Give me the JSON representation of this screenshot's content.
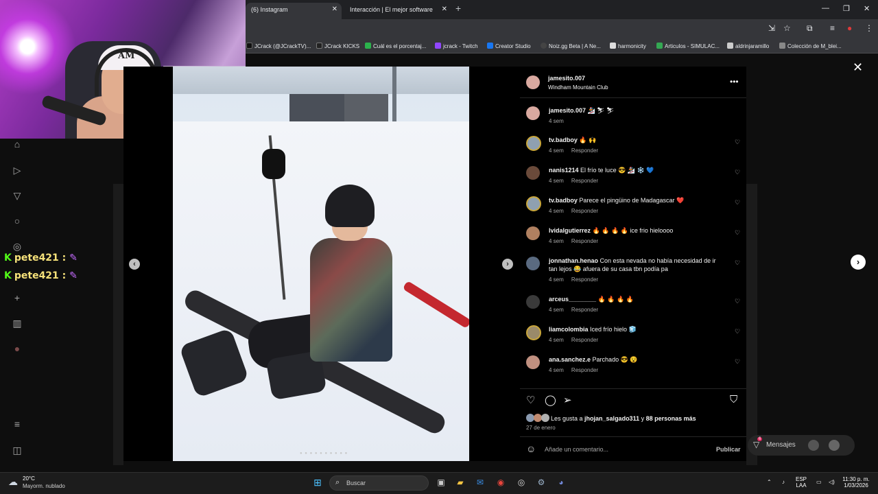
{
  "browser": {
    "tabs": [
      {
        "label": "(6) Instagram"
      },
      {
        "label": "Interacción | El mejor software"
      }
    ],
    "bookmarks": [
      {
        "label": "JCrack (@JCrackTV)...",
        "color": "#111111"
      },
      {
        "label": "JCrack KICKS",
        "color": "#222222"
      },
      {
        "label": "Cuál es el porcentaj...",
        "color": "#2bb24c"
      },
      {
        "label": "jcrack - Twitch",
        "color": "#9146ff"
      },
      {
        "label": "Creator Studio",
        "color": "#1877f2"
      },
      {
        "label": "Noiz.gg Beta | A Ne...",
        "color": "#444444"
      },
      {
        "label": "harmonicity",
        "color": "#dddddd"
      },
      {
        "label": "Articulos - SIMULAC...",
        "color": "#34a853"
      },
      {
        "label": "aldrinjaramillo",
        "color": "#cccccc"
      },
      {
        "label": "Colección de M_blei...",
        "color": "#888888"
      }
    ]
  },
  "background_page": {
    "chat": [
      {
        "user": "pete421 :"
      },
      {
        "user": "pete421 :"
      }
    ],
    "messages_label": "Mensajes",
    "messages_badge": "6"
  },
  "post": {
    "username": "jamesito.007",
    "location": "Windham Mountain Club",
    "caption_user": "jamesito.007",
    "caption_emojis": "🏂 ⛷ ⛷",
    "caption_time": "4 sem",
    "comments": [
      {
        "user": "tv.badboy",
        "text": "🔥 🙌",
        "time": "4 sem",
        "reply": "Responder"
      },
      {
        "user": "nanis1214",
        "text": "El frío te luce 😎 🏂 ❄️ 💙",
        "time": "4 sem",
        "reply": "Responder"
      },
      {
        "user": "tv.badboy",
        "text": "Parece el pingüino de Madagascar ❤️",
        "time": "4 sem",
        "reply": "Responder"
      },
      {
        "user": "lvidalgutierrez",
        "text": "🔥 🔥 🔥 🔥 ice frio hieloooo",
        "time": "4 sem",
        "reply": "Responder"
      },
      {
        "user": "jonnathan.henao",
        "text": "Con esta nevada no había necesidad de ir",
        "text2": "tan lejos 😂 afuera de su casa tbn podía pa",
        "time": "4 sem",
        "reply": "Responder"
      },
      {
        "user": "arceus________",
        "text": "🔥 🔥 🔥 🔥",
        "time": "4 sem",
        "reply": "Responder"
      },
      {
        "user": "liamcolombia",
        "text": "Iced frío hielo 🧊",
        "time": "4 sem",
        "reply": "Responder"
      },
      {
        "user": "ana.sanchez.e",
        "text": "Parchado 😎 😵",
        "time": "4 sem",
        "reply": "Responder"
      }
    ],
    "likes_prefix": "Les gusta a ",
    "likes_user": "jhojan_salgado311",
    "likes_mid": " y ",
    "likes_rest": "88 personas más",
    "date": "27 de enero",
    "comment_placeholder": "Añade un comentario...",
    "publish_label": "Publicar"
  },
  "taskbar": {
    "temperature": "20°C",
    "weather": "Mayorm. nublado",
    "search_label": "Buscar",
    "lang1": "ESP",
    "lang2": "LAA",
    "time": "11:30 p. m.",
    "date": "1/03/2026"
  }
}
